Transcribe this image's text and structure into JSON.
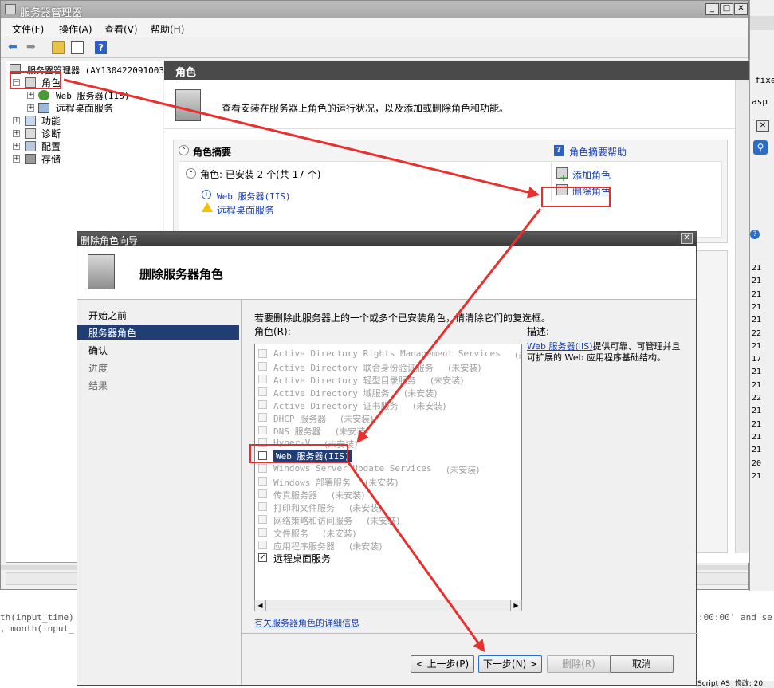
{
  "main_window": {
    "title": "服务器管理器",
    "menu": [
      "文件(F)",
      "操作(A)",
      "查看(V)",
      "帮助(H)"
    ],
    "tree": {
      "root": "服务器管理器 (AY130422091003",
      "roles": "角色",
      "web_server": "Web 服务器(IIS)",
      "rds": "远程桌面服务",
      "features": "功能",
      "diagnostics": "诊断",
      "config": "配置",
      "storage": "存储"
    },
    "header": "角色",
    "intro": "查看安装在服务器上角色的运行状况，以及添加或删除角色和功能。",
    "summary_title": "角色摘要",
    "summary_help": "角色摘要帮助",
    "roles_count": "角色: 已安装 2 个(共 17 个)",
    "installed_roles": [
      "Web 服务器(IIS)",
      "远程桌面服务"
    ],
    "add_role": "添加角色",
    "remove_role": "删除角色"
  },
  "background": {
    "right_text_1": "fixed",
    "right_text_2": "asp",
    "bottom_left_1": "th(input_time)",
    "bottom_left_2": ", month(input_",
    "bottom_right": ":00:00' and se",
    "status_1": "Script AS",
    "status_2": "修改: 20",
    "right_numbers": [
      "21",
      "21",
      "21",
      "21",
      "21",
      "22",
      "21",
      "17",
      "21",
      "21",
      "22",
      "21",
      "21",
      "21",
      "21",
      "20",
      "21"
    ]
  },
  "dialog": {
    "title": "删除角色向导",
    "heading": "删除服务器角色",
    "nav": [
      "开始之前",
      "服务器角色",
      "确认",
      "进度",
      "结果"
    ],
    "nav_active": 1,
    "instruction": "若要删除此服务器上的一个或多个已安装角色，请清除它们的复选框。",
    "roles_label": "角色(R):",
    "roles": [
      {
        "name": "Active Directory Rights Management Services",
        "status": "(未安装)",
        "enabled": false,
        "checked": false
      },
      {
        "name": "Active Directory 联合身份验证服务",
        "status": "(未安装)",
        "enabled": false,
        "checked": false
      },
      {
        "name": "Active Directory 轻型目录服务",
        "status": "(未安装)",
        "enabled": false,
        "checked": false
      },
      {
        "name": "Active Directory 域服务",
        "status": "(未安装)",
        "enabled": false,
        "checked": false
      },
      {
        "name": "Active Directory 证书服务",
        "status": "(未安装)",
        "enabled": false,
        "checked": false
      },
      {
        "name": "DHCP 服务器",
        "status": "(未安装)",
        "enabled": false,
        "checked": false
      },
      {
        "name": "DNS 服务器",
        "status": "(未安装)",
        "enabled": false,
        "checked": false
      },
      {
        "name": "Hyper-V",
        "status": "(未安装)",
        "enabled": false,
        "checked": false
      },
      {
        "name": "Web 服务器(IIS)",
        "status": "",
        "enabled": true,
        "checked": false,
        "selected": true
      },
      {
        "name": "Windows Server Update Services",
        "status": "(未安装)",
        "enabled": false,
        "checked": false
      },
      {
        "name": "Windows 部署服务",
        "status": "(未安装)",
        "enabled": false,
        "checked": false
      },
      {
        "name": "传真服务器",
        "status": "(未安装)",
        "enabled": false,
        "checked": false
      },
      {
        "name": "打印和文件服务",
        "status": "(未安装)",
        "enabled": false,
        "checked": false
      },
      {
        "name": "网络策略和访问服务",
        "status": "(未安装)",
        "enabled": false,
        "checked": false
      },
      {
        "name": "文件服务",
        "status": "(未安装)",
        "enabled": false,
        "checked": false
      },
      {
        "name": "应用程序服务器",
        "status": "(未安装)",
        "enabled": false,
        "checked": false
      },
      {
        "name": "远程桌面服务",
        "status": "",
        "enabled": true,
        "checked": true
      }
    ],
    "desc_label": "描述:",
    "desc_link": "Web 服务器(IIS)",
    "desc_text": "提供可靠、可管理并且可扩展的 Web 应用程序基础结构。",
    "more_info": "有关服务器角色的详细信息",
    "buttons": {
      "prev": "< 上一步(P)",
      "next": "下一步(N) >",
      "remove": "删除(R)",
      "cancel": "取消"
    }
  }
}
